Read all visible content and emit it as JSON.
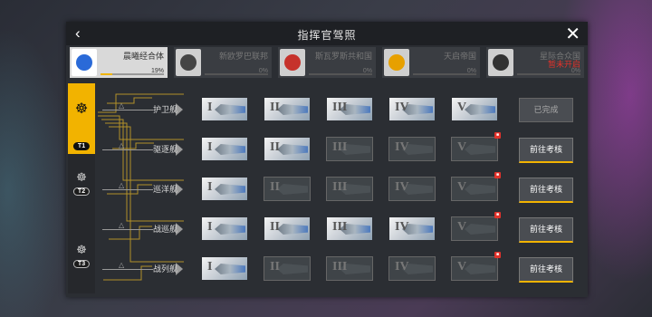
{
  "header": {
    "title": "指挥官驾照"
  },
  "colors": {
    "accent": "#f2b300",
    "locked": "#e0322b",
    "panel": "#2b2e33"
  },
  "factions": [
    {
      "name": "晨曦经合体",
      "percent": "19%",
      "progress": 0.19,
      "active": true,
      "emblem": "sphere-icon",
      "color": "#2a6ad8"
    },
    {
      "name": "新欧罗巴联邦",
      "percent": "0%",
      "progress": 0,
      "active": false,
      "emblem": "cross-icon",
      "color": "#444444"
    },
    {
      "name": "斯瓦罗斯共和国",
      "percent": "0%",
      "progress": 0,
      "active": false,
      "emblem": "star-icon",
      "color": "#c6322b"
    },
    {
      "name": "天启帝国",
      "percent": "0%",
      "progress": 0,
      "active": false,
      "emblem": "knot-icon",
      "color": "#e7a000"
    },
    {
      "name": "星际合众国",
      "percent": "0%",
      "progress": 0,
      "active": false,
      "emblem": "cube-icon",
      "color": "#333333",
      "overlay": "暂未开启"
    }
  ],
  "tiers": [
    {
      "badge": "T1",
      "active": true
    },
    {
      "badge": "T2",
      "active": false
    },
    {
      "badge": "T3",
      "active": false
    }
  ],
  "stage_numerals": [
    "I",
    "II",
    "III",
    "IV",
    "V"
  ],
  "rows": [
    {
      "name": "护卫舰",
      "stages": [
        "on",
        "on",
        "on",
        "on",
        "on"
      ],
      "locks": [
        false,
        false,
        false,
        false,
        false
      ],
      "action": "已完成",
      "action_type": "done"
    },
    {
      "name": "驱逐舰",
      "stages": [
        "on",
        "on",
        "off",
        "off",
        "off"
      ],
      "locks": [
        false,
        false,
        false,
        false,
        true
      ],
      "action": "前往考核",
      "action_type": "go"
    },
    {
      "name": "巡洋舰",
      "stages": [
        "on",
        "off",
        "off",
        "off",
        "off"
      ],
      "locks": [
        false,
        false,
        false,
        false,
        true
      ],
      "action": "前往考核",
      "action_type": "go"
    },
    {
      "name": "战巡舰",
      "stages": [
        "on",
        "on",
        "on",
        "on",
        "off"
      ],
      "locks": [
        false,
        false,
        false,
        false,
        true
      ],
      "action": "前往考核",
      "action_type": "go"
    },
    {
      "name": "战列舰",
      "stages": [
        "on",
        "off",
        "off",
        "off",
        "off"
      ],
      "locks": [
        false,
        false,
        false,
        false,
        true
      ],
      "action": "前往考核",
      "action_type": "go"
    }
  ]
}
